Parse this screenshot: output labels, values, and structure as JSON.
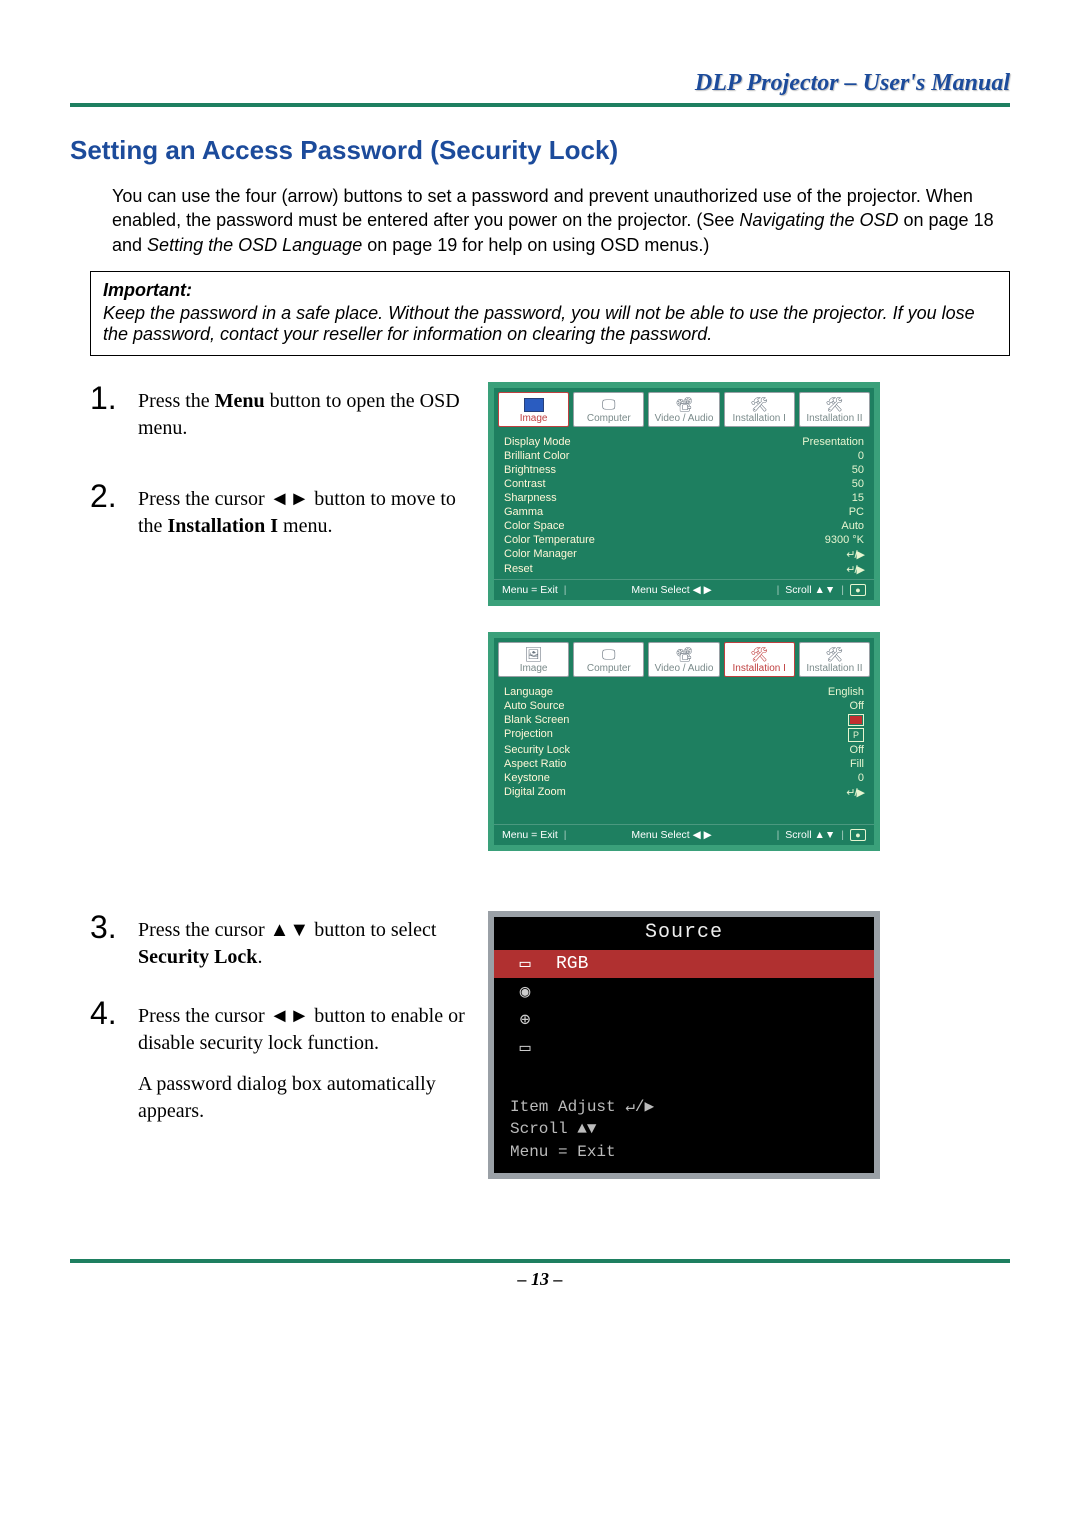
{
  "header": {
    "title": "DLP Projector – User's Manual"
  },
  "section_title": "Setting an Access Password (Security Lock)",
  "intro": {
    "line1": "You can use the four (arrow) buttons to set a password and prevent unauthorized use of the projector. When enabled, the password must be entered after you power on the projector. (See ",
    "ital1": "Navigating the OSD",
    "mid1": " on page 18 and ",
    "ital2": "Setting the OSD Language",
    "tail": " on page 19 for help on using OSD menus.)"
  },
  "important": {
    "head": "Important:",
    "body": "Keep the password in a safe place. Without the password, you will not be able to use the projector. If you lose the password, contact your reseller for information on clearing the password."
  },
  "steps": {
    "s1_num": "1.",
    "s1_a": "Press the ",
    "s1_b": "Menu",
    "s1_c": " button to open the OSD menu.",
    "s2_num": "2.",
    "s2_a": "Press the cursor ◄► button to move to the ",
    "s2_b": "Installation I",
    "s2_c": " menu.",
    "s3_num": "3.",
    "s3_a": "Press the cursor ▲▼ button to select ",
    "s3_b": "Security Lock",
    "s3_c": ".",
    "s4_num": "4.",
    "s4_a": "Press the cursor ◄► button to enable or disable security lock function.",
    "s4_b": "A password dialog box automatically appears."
  },
  "osd_tabs": {
    "t1": "Image",
    "t2": "Computer",
    "t3": "Video / Audio",
    "t4": "Installation I",
    "t5": "Installation II"
  },
  "osd1": {
    "items": [
      {
        "label": "Display Mode",
        "value": "Presentation"
      },
      {
        "label": "Brilliant Color",
        "value": "0"
      },
      {
        "label": "Brightness",
        "value": "50"
      },
      {
        "label": "Contrast",
        "value": "50"
      },
      {
        "label": "Sharpness",
        "value": "15"
      },
      {
        "label": "Gamma",
        "value": "PC"
      },
      {
        "label": "Color Space",
        "value": "Auto"
      },
      {
        "label": "Color Temperature",
        "value": "9300 °K"
      },
      {
        "label": "Color Manager",
        "value": "↵/▶"
      },
      {
        "label": "Reset",
        "value": "↵/▶"
      }
    ]
  },
  "osd2": {
    "items": [
      {
        "label": "Language",
        "value": "English"
      },
      {
        "label": "Auto Source",
        "value": "Off"
      },
      {
        "label": "Blank Screen",
        "value": "[red]"
      },
      {
        "label": "Projection",
        "value": "[P]"
      },
      {
        "label": "Security Lock",
        "value": "Off"
      },
      {
        "label": "Aspect Ratio",
        "value": "Fill"
      },
      {
        "label": "Keystone",
        "value": "0"
      },
      {
        "label": "Digital Zoom",
        "value": "↵/▶"
      }
    ]
  },
  "osd_foot": {
    "exit": "Menu = Exit",
    "select": "Menu Select ◀ ▶",
    "scroll": "Scroll ▲▼"
  },
  "source": {
    "title": "Source",
    "rows": [
      {
        "icon": "▭",
        "label": "RGB",
        "sel": true
      },
      {
        "icon": "◉",
        "label": "",
        "sel": false
      },
      {
        "icon": "⊕",
        "label": "",
        "sel": false
      },
      {
        "icon": "▭",
        "label": "",
        "sel": false
      }
    ],
    "foot1": "Item Adjust ↵/▶",
    "foot2": "Scroll ▲▼",
    "foot3": "Menu = Exit"
  },
  "page_number": "– 13 –"
}
